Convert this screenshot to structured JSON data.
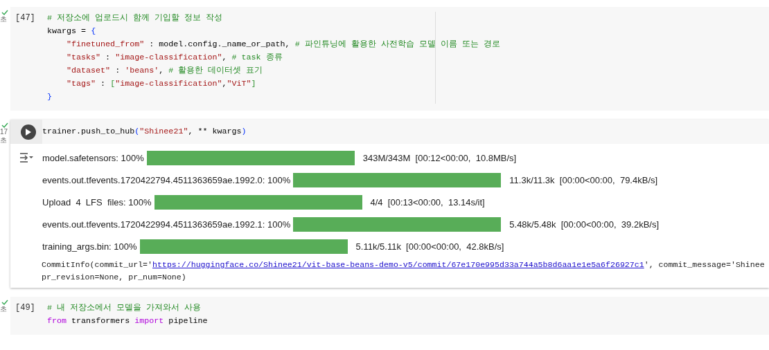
{
  "cells": [
    {
      "selected": false,
      "time": [
        "초"
      ],
      "prompt": {
        "kind": "count",
        "text": "[47]"
      },
      "ruler": true,
      "lines": [
        {
          "tokens": [
            {
              "kind": "comment",
              "text": "# 저장소에 업로드시 함께 기입할 정보 작성"
            }
          ]
        },
        {
          "tokens": [
            {
              "kind": "plain",
              "text": "kwargs = "
            },
            {
              "kind": "brace",
              "text": "{"
            }
          ],
          "children": [
            {
              "tokens": [
                {
                  "kind": "string",
                  "text": "\"finetuned_from\""
                },
                {
                  "kind": "plain",
                  "text": " : model.config._name_or_path, "
                },
                {
                  "kind": "comment",
                  "text": "# 파인튜닝에 활용한 사전학습 모델 이름 또는 경로"
                }
              ]
            },
            {
              "tokens": [
                {
                  "kind": "string",
                  "text": "\"tasks\""
                },
                {
                  "kind": "plain",
                  "text": " : "
                },
                {
                  "kind": "string",
                  "text": "\"image-classification\""
                },
                {
                  "kind": "plain",
                  "text": ", "
                },
                {
                  "kind": "comment",
                  "text": "# task 종류"
                }
              ]
            },
            {
              "tokens": [
                {
                  "kind": "string",
                  "text": "\"dataset\""
                },
                {
                  "kind": "plain",
                  "text": " : "
                },
                {
                  "kind": "string",
                  "text": "'beans'"
                },
                {
                  "kind": "plain",
                  "text": ", "
                },
                {
                  "kind": "comment",
                  "text": "# 활용한 데이터셋 표기"
                }
              ]
            },
            {
              "tokens": [
                {
                  "kind": "string",
                  "text": "\"tags\""
                },
                {
                  "kind": "plain",
                  "text": " : "
                },
                {
                  "kind": "bracket",
                  "text": "["
                },
                {
                  "kind": "string",
                  "text": "\"image-classification\""
                },
                {
                  "kind": "plain",
                  "text": ","
                },
                {
                  "kind": "string",
                  "text": "\"ViT\""
                },
                {
                  "kind": "bracket",
                  "text": "]"
                }
              ]
            }
          ]
        },
        {
          "tokens": [
            {
              "kind": "brace",
              "text": "}"
            }
          ]
        }
      ]
    },
    {
      "selected": true,
      "time": [
        "17",
        "초"
      ],
      "prompt": {
        "kind": "run_button"
      },
      "ruler": false,
      "lines": [
        {
          "tokens": [
            {
              "kind": "plain",
              "text": "trainer.push_to_hub"
            },
            {
              "kind": "brace",
              "text": "("
            },
            {
              "kind": "string",
              "text": "\"Shinee21\""
            },
            {
              "kind": "plain",
              "text": ", ** kwargs"
            },
            {
              "kind": "brace",
              "text": ")"
            }
          ]
        }
      ],
      "outputs": [
        {
          "kind": "progress",
          "label": "model.safetensors: 100%",
          "level": 1,
          "info": "343M/343M  [00:12<00:00,  10.8MB/s]"
        },
        {
          "kind": "progress",
          "label": "events.out.tfevents.1720422794.4511363659ae.1992.0: 100%",
          "level": 1,
          "info": "11.3k/11.3k  [00:00<00:00,  79.4kB/s]"
        },
        {
          "kind": "progress",
          "label": "Upload  4  LFS  files: 100%",
          "level": 1,
          "info": "4/4  [00:13<00:00,  13.14s/it]"
        },
        {
          "kind": "progress",
          "label": "events.out.tfevents.1720422994.4511363659ae.1992.1: 100%",
          "level": 1,
          "info": "5.48k/5.48k  [00:00<00:00,  39.2kB/s]"
        },
        {
          "kind": "progress",
          "label": "training_args.bin: 100%",
          "level": 1,
          "info": "5.11k/5.11k  [00:00<00:00,  42.8kB/s]"
        },
        {
          "kind": "text",
          "before": "CommitInfo(commit_url='",
          "link": "https://huggingface.co/Shinee21/vit-base-beans-demo-v5/commit/67e170e995d33a744a5b8d6aa1e1e5a6f26927c1",
          "after": "', commit_message='Shinee",
          "next_line": "pr_revision=None, pr_num=None)"
        }
      ]
    },
    {
      "selected": false,
      "time": [
        "초"
      ],
      "prompt": {
        "kind": "count",
        "text": "[49]"
      },
      "ruler": false,
      "lines": [
        {
          "tokens": [
            {
              "kind": "comment",
              "text": "# 내 저장소에서 모델을 가져와서 사용"
            }
          ]
        },
        {
          "tokens": [
            {
              "kind": "keyword",
              "text": "from"
            },
            {
              "kind": "plain",
              "text": " transformers "
            },
            {
              "kind": "keyword",
              "text": "import"
            },
            {
              "kind": "plain",
              "text": " pipeline"
            }
          ]
        }
      ]
    }
  ]
}
